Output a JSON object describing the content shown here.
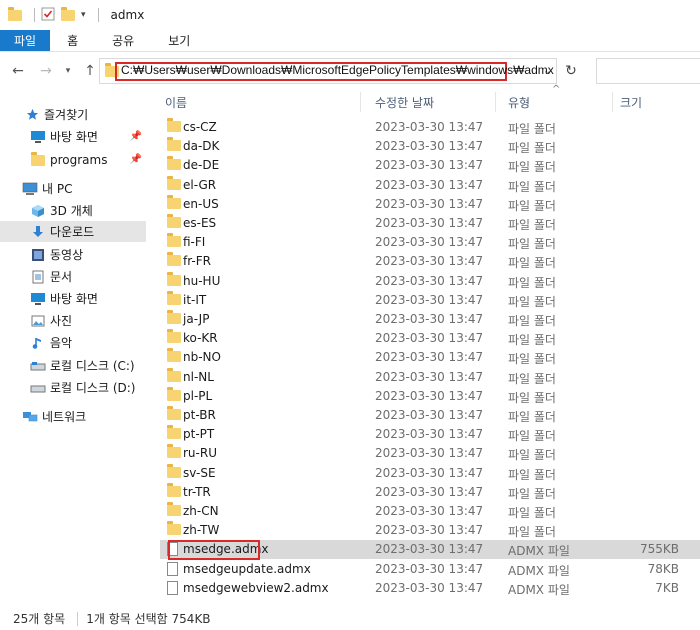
{
  "window": {
    "title": "admx"
  },
  "ribbon": {
    "tabs": [
      "파일",
      "홈",
      "공유",
      "보기"
    ]
  },
  "address": {
    "path": "C:₩Users₩user₩Downloads₩MicrosoftEdgePolicyTemplates₩windows₩admx"
  },
  "sidebar": {
    "items": [
      {
        "label": "즐겨찾기",
        "icon": "star-icon",
        "pinned": false,
        "selected": false
      },
      {
        "label": "바탕 화면",
        "icon": "desktop-icon",
        "pinned": true,
        "selected": false
      },
      {
        "label": "programs",
        "icon": "folder-icon",
        "pinned": true,
        "selected": false
      },
      {
        "label": "내 PC",
        "icon": "computer-icon",
        "pinned": false,
        "selected": false
      },
      {
        "label": "3D 개체",
        "icon": "cube-icon",
        "pinned": false,
        "selected": false
      },
      {
        "label": "다운로드",
        "icon": "download-icon",
        "pinned": false,
        "selected": true
      },
      {
        "label": "동영상",
        "icon": "video-icon",
        "pinned": false,
        "selected": false
      },
      {
        "label": "문서",
        "icon": "document-icon",
        "pinned": false,
        "selected": false
      },
      {
        "label": "바탕 화면",
        "icon": "desktop-icon",
        "pinned": false,
        "selected": false
      },
      {
        "label": "사진",
        "icon": "picture-icon",
        "pinned": false,
        "selected": false
      },
      {
        "label": "음악",
        "icon": "music-icon",
        "pinned": false,
        "selected": false
      },
      {
        "label": "로컬 디스크 (C:)",
        "icon": "drive-icon",
        "pinned": false,
        "selected": false
      },
      {
        "label": "로컬 디스크 (D:)",
        "icon": "drive-icon",
        "pinned": false,
        "selected": false
      },
      {
        "label": "네트워크",
        "icon": "network-icon",
        "pinned": false,
        "selected": false
      }
    ]
  },
  "columns": {
    "name": "이름",
    "date": "수정한 날짜",
    "type": "유형",
    "size": "크기"
  },
  "files": [
    {
      "name": "cs-CZ",
      "date": "2023-03-30 13:47",
      "type": "파일 폴더",
      "size": "",
      "kind": "folder"
    },
    {
      "name": "da-DK",
      "date": "2023-03-30 13:47",
      "type": "파일 폴더",
      "size": "",
      "kind": "folder"
    },
    {
      "name": "de-DE",
      "date": "2023-03-30 13:47",
      "type": "파일 폴더",
      "size": "",
      "kind": "folder"
    },
    {
      "name": "el-GR",
      "date": "2023-03-30 13:47",
      "type": "파일 폴더",
      "size": "",
      "kind": "folder"
    },
    {
      "name": "en-US",
      "date": "2023-03-30 13:47",
      "type": "파일 폴더",
      "size": "",
      "kind": "folder"
    },
    {
      "name": "es-ES",
      "date": "2023-03-30 13:47",
      "type": "파일 폴더",
      "size": "",
      "kind": "folder"
    },
    {
      "name": "fi-FI",
      "date": "2023-03-30 13:47",
      "type": "파일 폴더",
      "size": "",
      "kind": "folder"
    },
    {
      "name": "fr-FR",
      "date": "2023-03-30 13:47",
      "type": "파일 폴더",
      "size": "",
      "kind": "folder"
    },
    {
      "name": "hu-HU",
      "date": "2023-03-30 13:47",
      "type": "파일 폴더",
      "size": "",
      "kind": "folder"
    },
    {
      "name": "it-IT",
      "date": "2023-03-30 13:47",
      "type": "파일 폴더",
      "size": "",
      "kind": "folder"
    },
    {
      "name": "ja-JP",
      "date": "2023-03-30 13:47",
      "type": "파일 폴더",
      "size": "",
      "kind": "folder"
    },
    {
      "name": "ko-KR",
      "date": "2023-03-30 13:47",
      "type": "파일 폴더",
      "size": "",
      "kind": "folder"
    },
    {
      "name": "nb-NO",
      "date": "2023-03-30 13:47",
      "type": "파일 폴더",
      "size": "",
      "kind": "folder"
    },
    {
      "name": "nl-NL",
      "date": "2023-03-30 13:47",
      "type": "파일 폴더",
      "size": "",
      "kind": "folder"
    },
    {
      "name": "pl-PL",
      "date": "2023-03-30 13:47",
      "type": "파일 폴더",
      "size": "",
      "kind": "folder"
    },
    {
      "name": "pt-BR",
      "date": "2023-03-30 13:47",
      "type": "파일 폴더",
      "size": "",
      "kind": "folder"
    },
    {
      "name": "pt-PT",
      "date": "2023-03-30 13:47",
      "type": "파일 폴더",
      "size": "",
      "kind": "folder"
    },
    {
      "name": "ru-RU",
      "date": "2023-03-30 13:47",
      "type": "파일 폴더",
      "size": "",
      "kind": "folder"
    },
    {
      "name": "sv-SE",
      "date": "2023-03-30 13:47",
      "type": "파일 폴더",
      "size": "",
      "kind": "folder"
    },
    {
      "name": "tr-TR",
      "date": "2023-03-30 13:47",
      "type": "파일 폴더",
      "size": "",
      "kind": "folder"
    },
    {
      "name": "zh-CN",
      "date": "2023-03-30 13:47",
      "type": "파일 폴더",
      "size": "",
      "kind": "folder"
    },
    {
      "name": "zh-TW",
      "date": "2023-03-30 13:47",
      "type": "파일 폴더",
      "size": "",
      "kind": "folder"
    },
    {
      "name": "msedge.admx",
      "date": "2023-03-30 13:47",
      "type": "ADMX 파일",
      "size": "755KB",
      "kind": "file",
      "selected": true
    },
    {
      "name": "msedgeupdate.admx",
      "date": "2023-03-30 13:47",
      "type": "ADMX 파일",
      "size": "78KB",
      "kind": "file"
    },
    {
      "name": "msedgewebview2.admx",
      "date": "2023-03-30 13:47",
      "type": "ADMX 파일",
      "size": "7KB",
      "kind": "file"
    }
  ],
  "status": {
    "count": "25개 항목",
    "selection": "1개 항목 선택함 754KB"
  },
  "colors": {
    "accent": "#1979ca",
    "highlight": "#d82a2a",
    "folder": "#f8d372",
    "selected_row": "#d9d9d9"
  }
}
